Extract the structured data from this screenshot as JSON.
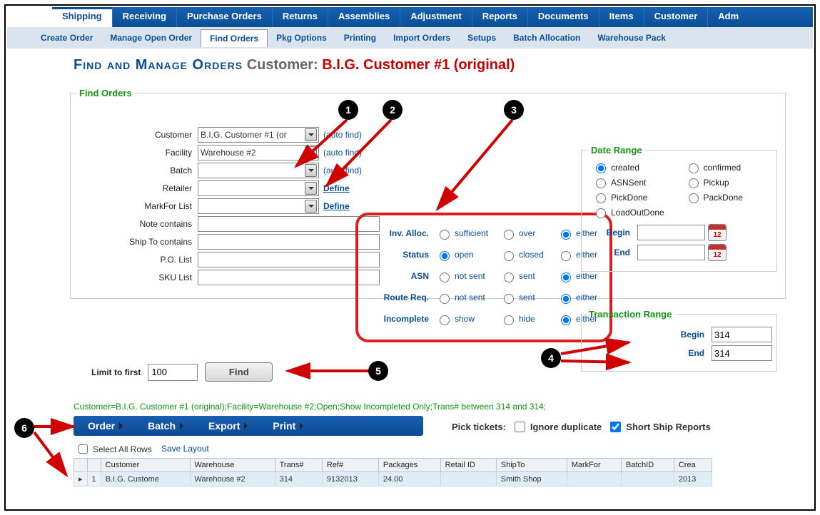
{
  "topnav": [
    "Shipping",
    "Receiving",
    "Purchase Orders",
    "Returns",
    "Assemblies",
    "Adjustment",
    "Reports",
    "Documents",
    "Items",
    "Customer",
    "Adm"
  ],
  "topnav_active": "Shipping",
  "subnav": [
    "Create Order",
    "Manage Open Order",
    "Find Orders",
    "Pkg Options",
    "Printing",
    "Import Orders",
    "Setups",
    "Batch Allocation",
    "Warehouse Pack"
  ],
  "subnav_active": "Find Orders",
  "title": {
    "main": "Find and Manage Orders",
    "sub": "Customer:",
    "cust": "B.I.G. Customer #1 (original)"
  },
  "find": {
    "legend": "Find Orders",
    "customer_label": "Customer",
    "customer_value": "B.I.G. Customer #1 (or",
    "customer_hint": "(auto find)",
    "facility_label": "Facility",
    "facility_value": "Warehouse #2",
    "facility_hint": "(auto find)",
    "batch_label": "Batch",
    "batch_value": "",
    "batch_hint": "(auto find)",
    "retailer_label": "Retailer",
    "retailer_value": "",
    "retailer_hint": "Define",
    "markfor_label": "MarkFor List",
    "markfor_value": "",
    "markfor_hint": "Define",
    "note_label": "Note contains",
    "note_value": "",
    "shipto_label": "Ship To contains",
    "shipto_value": "",
    "po_label": "P.O. List",
    "po_value": "",
    "sku_label": "SKU List",
    "sku_value": ""
  },
  "filters": {
    "inv_alloc": {
      "label": "Inv. Alloc.",
      "a": "sufficient",
      "b": "over",
      "c": "either",
      "selected": "c"
    },
    "status": {
      "label": "Status",
      "a": "open",
      "b": "closed",
      "c": "either",
      "selected": "a"
    },
    "asn": {
      "label": "ASN",
      "a": "not sent",
      "b": "sent",
      "c": "either",
      "selected": "c"
    },
    "route": {
      "label": "Route Req.",
      "a": "not sent",
      "b": "sent",
      "c": "either",
      "selected": "c"
    },
    "incomplete": {
      "label": "Incomplete",
      "a": "show",
      "b": "hide",
      "c": "either",
      "selected": "c"
    }
  },
  "date_range": {
    "legend": "Date Range",
    "options": [
      "created",
      "confirmed",
      "ASNSent",
      "Pickup",
      "PickDone",
      "PackDone",
      "LoadOutDone"
    ],
    "selected": "created",
    "begin_label": "Begin",
    "begin_value": "",
    "end_label": "End",
    "end_value": "",
    "cal_text": "12"
  },
  "trans_range": {
    "legend": "Transaction Range",
    "begin_label": "Begin",
    "begin_value": "314",
    "end_label": "End",
    "end_value": "314"
  },
  "limit": {
    "label": "Limit to first",
    "value": "100",
    "button": "Find"
  },
  "query_string": "Customer=B.I.G. Customer #1 (original);Facility=Warehouse #2;Open;Show Incompleted Only;Trans# between 314 and 314;",
  "action_bar": [
    "Order",
    "Batch",
    "Export",
    "Print"
  ],
  "pick": {
    "label": "Pick tickets:",
    "ignore": "Ignore duplicate",
    "ignore_checked": false,
    "short": "Short Ship Reports",
    "short_checked": true
  },
  "table": {
    "select_all": "Select All Rows",
    "save_layout": "Save Layout",
    "columns": [
      "Customer",
      "Warehouse",
      "Trans#",
      "Ref#",
      "Packages",
      "Retail ID",
      "ShipTo",
      "MarkFor",
      "BatchID",
      "Crea"
    ],
    "rows": [
      {
        "n": "1",
        "Customer": "B.I.G. Custome",
        "Warehouse": "Warehouse #2",
        "Trans#": "314",
        "Ref#": "9132013",
        "Packages": "24.00",
        "Retail ID": "",
        "ShipTo": "Smith Shop",
        "MarkFor": "",
        "BatchID": "",
        "Crea": "2013"
      }
    ]
  },
  "badges": {
    "1": "1",
    "2": "2",
    "3": "3",
    "4": "4",
    "5": "5",
    "6": "6"
  }
}
